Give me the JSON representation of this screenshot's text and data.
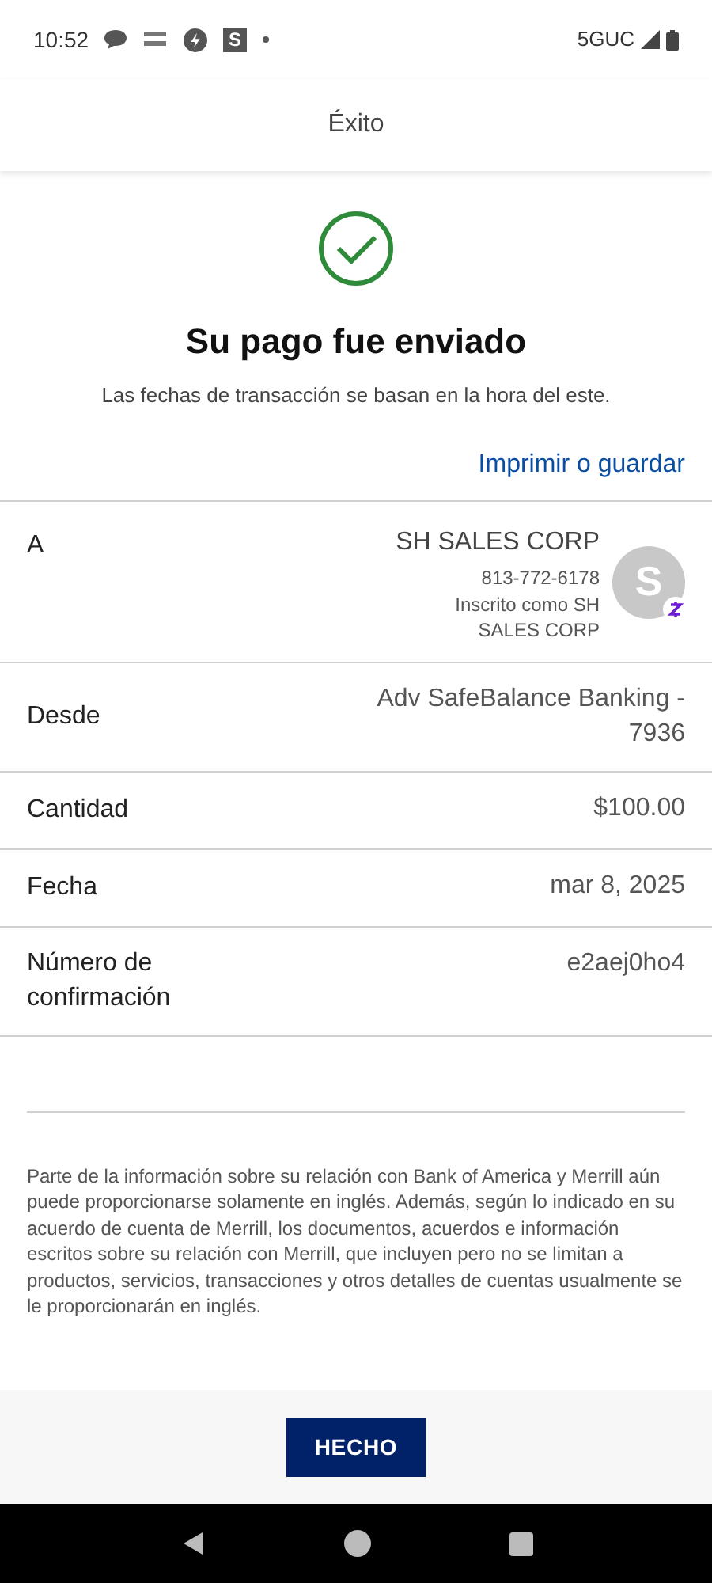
{
  "status_bar": {
    "time": "10:52",
    "app_letter": "S",
    "network": "5GUC"
  },
  "header": {
    "title": "Éxito"
  },
  "success": {
    "title": "Su pago fue enviado",
    "subtitle": "Las fechas de transacción se basan en la hora del este."
  },
  "print_link": "Imprimir o guardar",
  "rows": [
    {
      "kind": "recipient",
      "label": "A",
      "name": "SH SALES CORP",
      "phone": "813-772-6178",
      "note": "Inscrito como SH SALES CORP",
      "avatar_letter": "S"
    },
    {
      "kind": "plain",
      "label": "Desde",
      "value": "Adv SafeBalance Banking - 7936"
    },
    {
      "kind": "plain",
      "label": "Cantidad",
      "value": "$100.00"
    },
    {
      "kind": "plain",
      "label": "Fecha",
      "value": "mar 8, 2025"
    },
    {
      "kind": "plain",
      "label": "Número de confirmación",
      "value": "e2aej0ho4"
    }
  ],
  "disclaimer": "Parte de la información sobre su relación con Bank of America y Merrill aún puede proporcionarse solamente en inglés. Además, según lo indicado en su acuerdo de cuenta de Merrill, los documentos, acuerdos e información escritos sobre su relación con Merrill, que incluyen pero no se limitan a productos, servicios, transacciones y otros detalles de cuentas usualmente se le proporcionarán en inglés.",
  "done_button": "HECHO"
}
